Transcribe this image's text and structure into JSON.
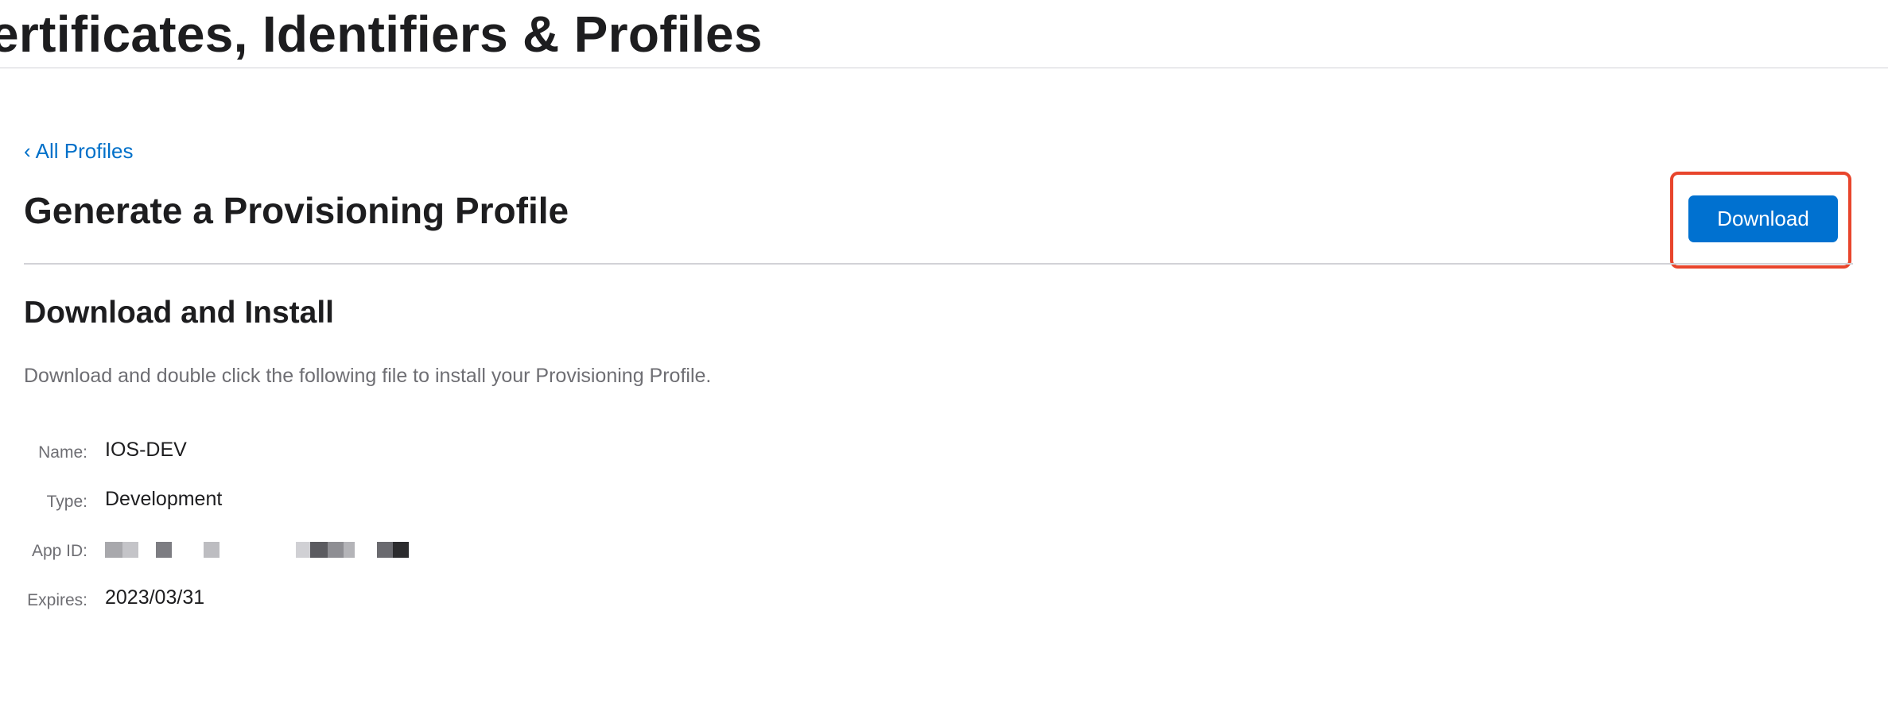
{
  "header": {
    "site_title": "ertificates, Identifiers & Profiles"
  },
  "nav": {
    "back_chevron": "‹",
    "back_label": "All Profiles"
  },
  "page": {
    "title": "Generate a Provisioning Profile",
    "download_label": "Download",
    "highlight_color": "#e8452c",
    "button_color": "#0071d0"
  },
  "section": {
    "title": "Download and Install",
    "description": "Download and double click the following file to install your Provisioning Profile."
  },
  "details": {
    "name_label": "Name:",
    "name_value": "IOS-DEV",
    "type_label": "Type:",
    "type_value": "Development",
    "app_id_label": "App ID:",
    "app_id_value": "(redacted)",
    "expires_label": "Expires:",
    "expires_value": "2023/03/31"
  }
}
